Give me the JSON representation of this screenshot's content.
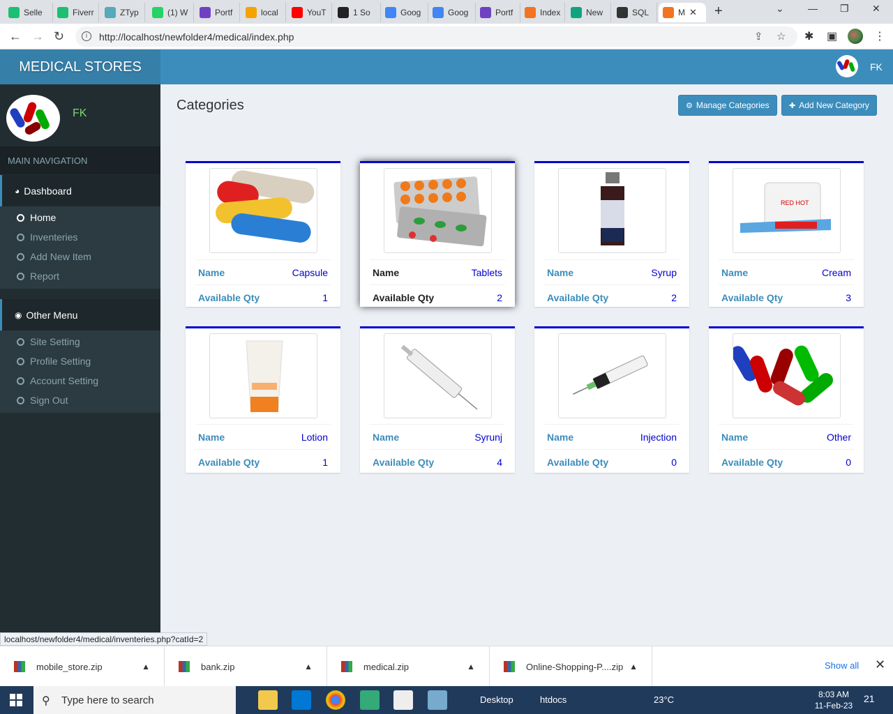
{
  "browser": {
    "tabs": [
      {
        "label": "Selle",
        "color": "#1dbf73"
      },
      {
        "label": "Fiverr",
        "color": "#1dbf73"
      },
      {
        "label": "ZTyp",
        "color": "#5ab"
      },
      {
        "label": "(1) W",
        "color": "#25d366"
      },
      {
        "label": "Portf",
        "color": "#6f42c1"
      },
      {
        "label": "local",
        "color": "#f4a300"
      },
      {
        "label": "YouT",
        "color": "#f00"
      },
      {
        "label": "1 So",
        "color": "#222"
      },
      {
        "label": "Goog",
        "color": "#4285f4"
      },
      {
        "label": "Goog",
        "color": "#4285f4"
      },
      {
        "label": "Portf",
        "color": "#6f42c1"
      },
      {
        "label": "Index",
        "color": "#f37321"
      },
      {
        "label": "New",
        "color": "#10a37f"
      },
      {
        "label": "SQL",
        "color": "#333"
      },
      {
        "label": "M",
        "color": "#f37321"
      }
    ],
    "url": "http://localhost/newfolder4/medical/index.php",
    "status_url": "localhost/newfolder4/medical/inventeries.php?catId=2"
  },
  "app": {
    "brand": "MEDICAL STORES",
    "user_name": "FK",
    "nav_header": "MAIN NAVIGATION",
    "dashboard_label": "Dashboard",
    "dashboard_items": [
      "Home",
      "Inventeries",
      "Add New Item",
      "Report"
    ],
    "other_label": "Other Menu",
    "other_items": [
      "Site Setting",
      "Profile Setting",
      "Account Setting",
      "Sign Out"
    ]
  },
  "content": {
    "title": "Categories",
    "manage_btn": "Manage Categories",
    "add_btn": "Add New Category",
    "name_key": "Name",
    "qty_key": "Available Qty",
    "cards": [
      {
        "name": "Capsule",
        "qty": "1",
        "icon": "capsule-image"
      },
      {
        "name": "Tablets",
        "qty": "2",
        "icon": "tablets-image"
      },
      {
        "name": "Syrup",
        "qty": "2",
        "icon": "syrup-image"
      },
      {
        "name": "Cream",
        "qty": "3",
        "icon": "cream-image"
      },
      {
        "name": "Lotion",
        "qty": "1",
        "icon": "lotion-image"
      },
      {
        "name": "Syrunj",
        "qty": "4",
        "icon": "syringe-image"
      },
      {
        "name": "Injection",
        "qty": "0",
        "icon": "injection-image"
      },
      {
        "name": "Other",
        "qty": "0",
        "icon": "other-pills-image"
      }
    ]
  },
  "downloads": {
    "files": [
      "mobile_store.zip",
      "bank.zip",
      "medical.zip",
      "Online-Shopping-P....zip"
    ],
    "show_all": "Show all"
  },
  "taskbar": {
    "search_placeholder": "Type here to search",
    "desktop": "Desktop",
    "htdocs": "htdocs",
    "temp": "23°C",
    "time": "8:03 AM",
    "date": "11-Feb-23",
    "notifications": "21"
  },
  "colors": {
    "primary": "#3c8dbc",
    "sidebar": "#222d32",
    "card_top": "#0000d0"
  }
}
